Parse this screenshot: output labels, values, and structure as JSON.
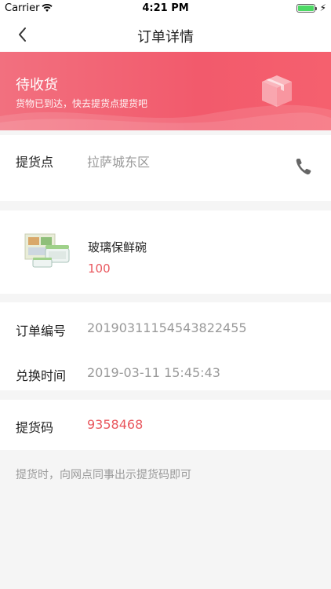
{
  "status_bar": {
    "carrier": "Carrier",
    "time": "4:21 PM"
  },
  "nav": {
    "title": "订单详情"
  },
  "banner": {
    "status": "待收货",
    "description": "货物已到达，快去提货点提货吧",
    "colors": {
      "start": "#f2707f",
      "end": "#f5606e"
    }
  },
  "pickup": {
    "label": "提货点",
    "location": "拉萨城东区"
  },
  "product": {
    "name": "玻璃保鲜碗",
    "price": "100"
  },
  "order": {
    "number_label": "订单编号",
    "number": "20190311154543822455",
    "time_label": "兑换时间",
    "time": "2019-03-11 15:45:43"
  },
  "pickup_code": {
    "label": "提货码",
    "code": "9358468"
  },
  "note": "提货时，向网点同事出示提货码即可",
  "accent_color": "#e9585f"
}
